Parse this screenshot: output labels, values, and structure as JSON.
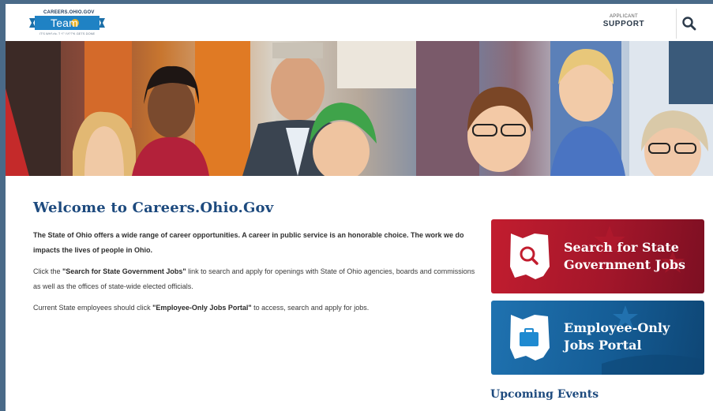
{
  "header": {
    "logo_top": "CAREERS.OHIO.GOV",
    "logo_main": "Team Ohio",
    "logo_sub": "IT'S WHERE THE WORK GETS DONE",
    "support_small": "APPLICANT",
    "support_big": "SUPPORT"
  },
  "main": {
    "title": "Welcome to Careers.Ohio.Gov",
    "intro": "The State of Ohio offers a wide range  of career opportunities. A career in public service is an honorable choice. The work we do impacts the lives of people in Ohio.",
    "p2_before": "Click the ",
    "p2_link": "\"Search for State Government Jobs\"",
    "p2_after": " link to search and apply for openings with State of Ohio agencies, boards and commissions as well as the offices of state-wide elected officials.",
    "p3_before": "Current State employees should click ",
    "p3_link": "\"Employee-Only Jobs Portal\"",
    "p3_after": " to access, search and apply for jobs."
  },
  "cards": {
    "search_label": "Search for State Government Jobs",
    "employee_label": "Employee-Only Jobs Portal"
  },
  "events": {
    "title": "Upcoming Events"
  },
  "colors": {
    "brand_blue": "#1d4a7e",
    "card_red": "#a3162a",
    "card_blue": "#155d96"
  },
  "icons": [
    "search-icon",
    "ohio-map-icon",
    "briefcase-icon"
  ]
}
